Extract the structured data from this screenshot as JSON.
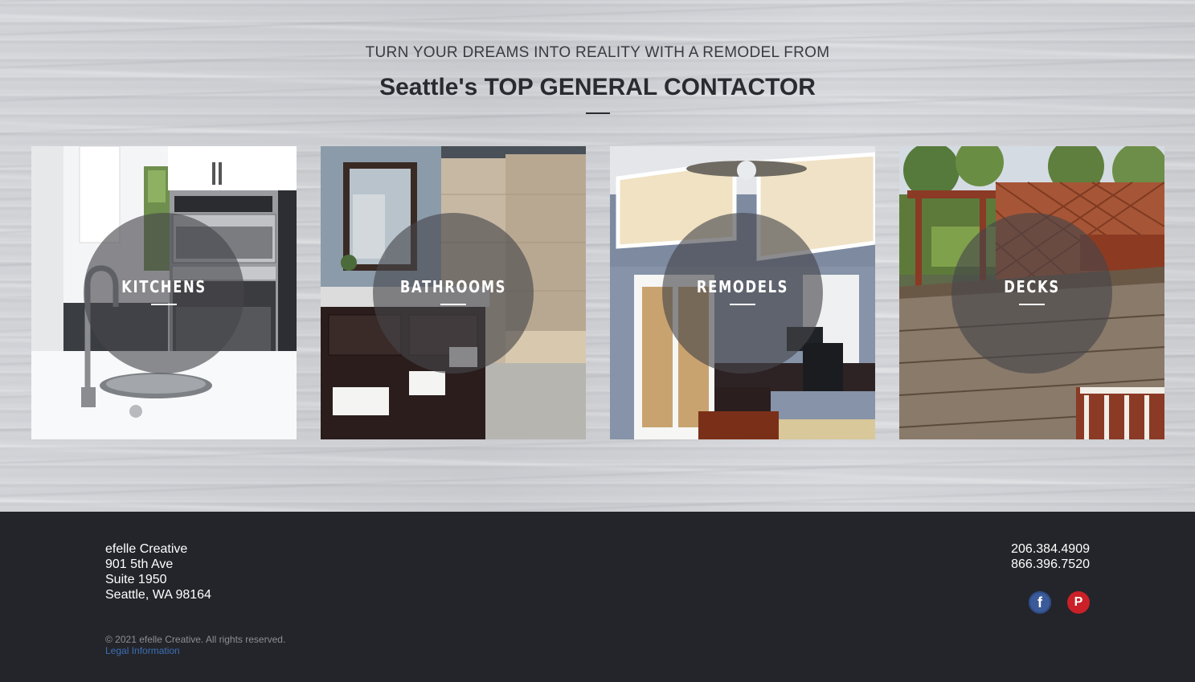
{
  "hero": {
    "eyebrow": "TURN YOUR DREAMS INTO REALITY WITH A REMODEL FROM",
    "headline": "Seattle's TOP GENERAL CONTACTOR"
  },
  "tiles": [
    {
      "label": "KITCHENS"
    },
    {
      "label": "BATHROOMS"
    },
    {
      "label": "REMODELS"
    },
    {
      "label": "DECKS"
    }
  ],
  "footer": {
    "company": "efelle Creative",
    "address_line1": "901 5th Ave",
    "address_line2": "Suite 1950",
    "address_line3": "Seattle, WA 98164",
    "phone1": "206.384.4909",
    "phone2": "866.396.7520",
    "copyright": "© 2021 efelle Creative. All rights reserved.",
    "legal_link": "Legal Information",
    "social": [
      {
        "icon": "facebook-icon",
        "glyph": "f"
      },
      {
        "icon": "pinterest-icon",
        "glyph": "P"
      }
    ]
  },
  "colors": {
    "footer_bg": "#24252a",
    "link": "#3b6fb5",
    "facebook": "#3b5a9a",
    "pinterest": "#cb2027"
  }
}
